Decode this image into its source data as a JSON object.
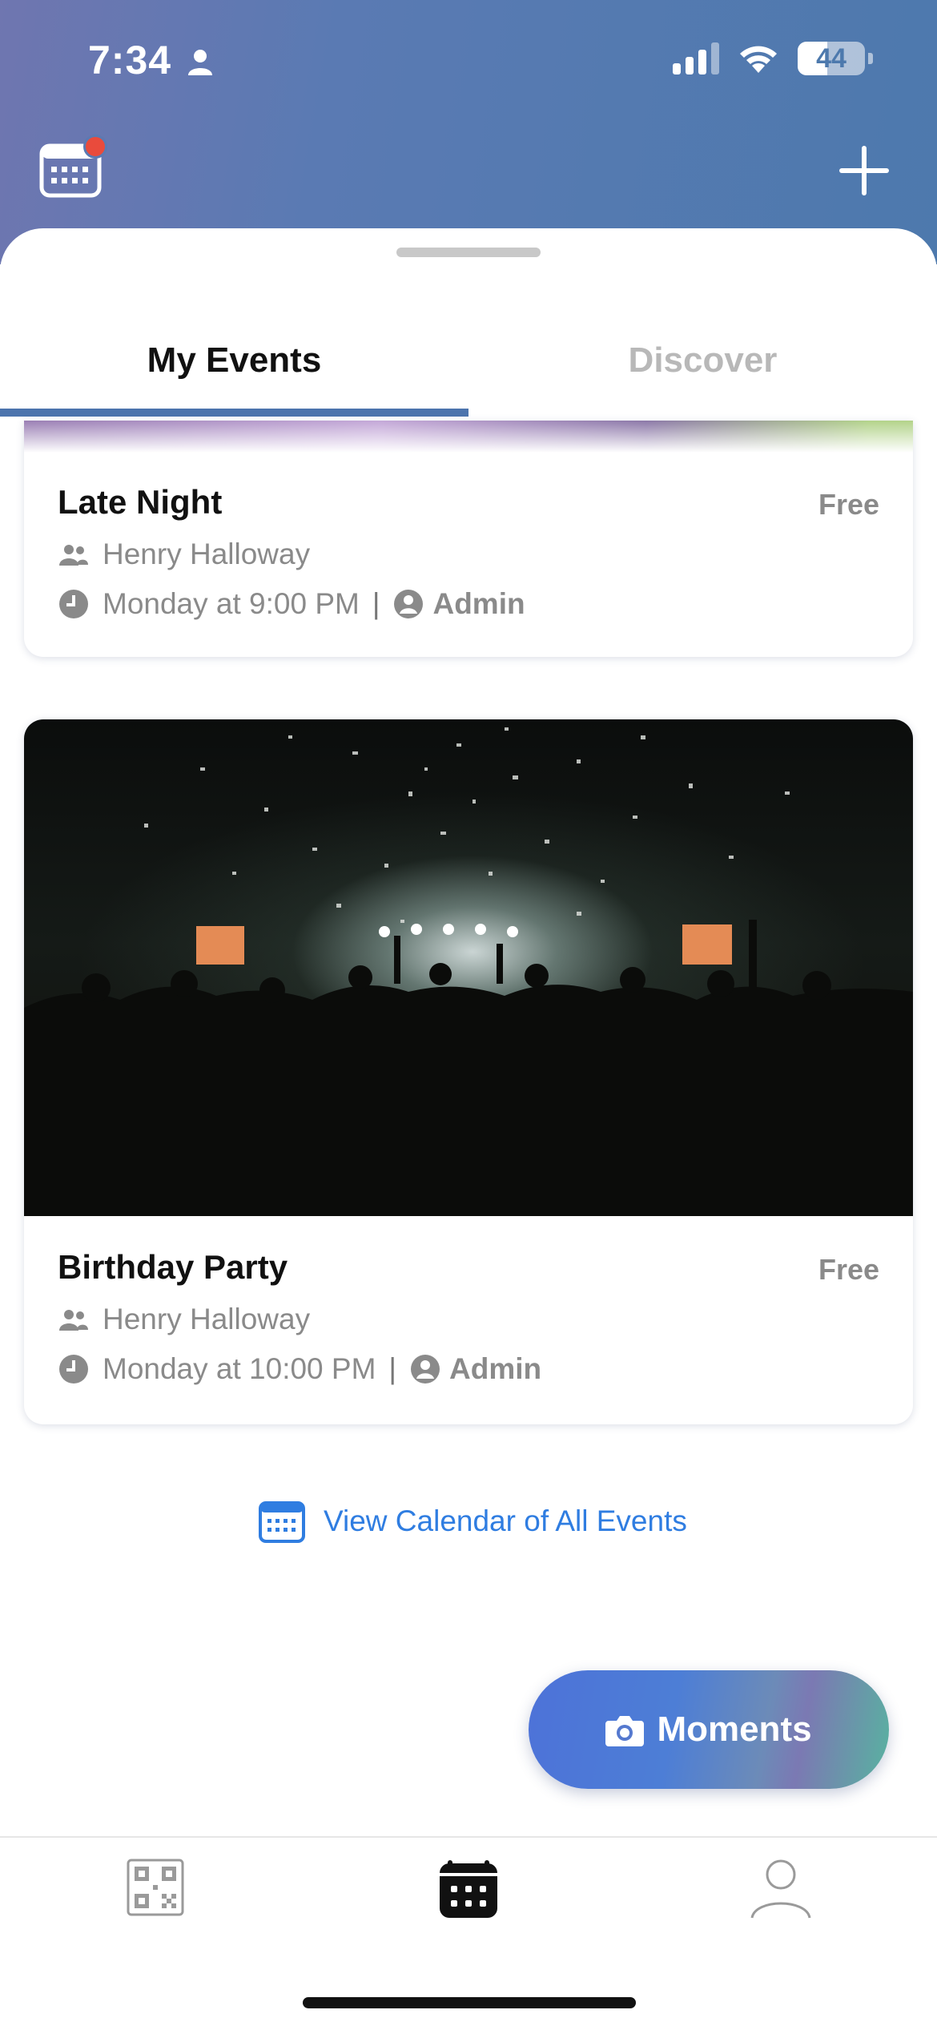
{
  "status_bar": {
    "time": "7:34",
    "battery": "44"
  },
  "header": {
    "notification_color": "#e94b3c",
    "accent": "#4c74ad"
  },
  "tabs": [
    {
      "label": "My Events",
      "active": true
    },
    {
      "label": "Discover",
      "active": false
    }
  ],
  "events": [
    {
      "title": "Late Night",
      "price": "Free",
      "host": "Henry Halloway",
      "time": "Monday at 9:00 PM",
      "separator": "|",
      "role": "Admin"
    },
    {
      "title": "Birthday Party",
      "price": "Free",
      "host": "Henry Halloway",
      "time": "Monday at 10:00 PM",
      "separator": "|",
      "role": "Admin"
    }
  ],
  "view_calendar": {
    "label": "View Calendar of All Events",
    "color": "#2f7de1"
  },
  "moments_button": {
    "label": "Moments"
  },
  "tab_bar": {
    "items": [
      {
        "icon": "qr-code-icon",
        "active": false
      },
      {
        "icon": "calendar-icon",
        "active": true
      },
      {
        "icon": "profile-icon",
        "active": false
      }
    ]
  }
}
